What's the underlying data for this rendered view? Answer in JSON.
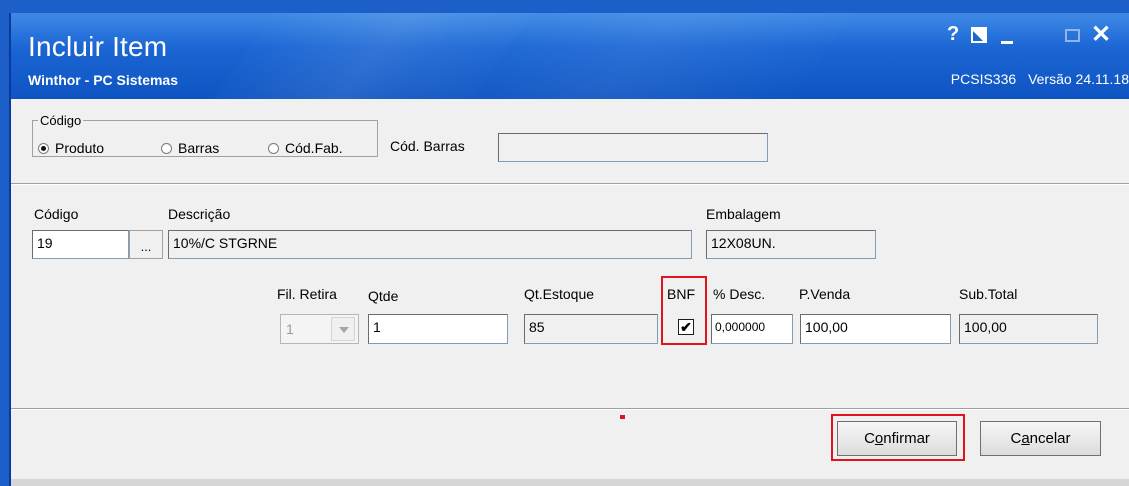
{
  "window": {
    "title": "Incluir Item",
    "subtitle": "Winthor - PC Sistemas",
    "program_code": "PCSIS336",
    "version": "Versão 24.11.18",
    "controls": {
      "help": "?",
      "close": "✕"
    }
  },
  "search": {
    "group_label": "Código",
    "options": [
      {
        "label": "Produto",
        "selected": true
      },
      {
        "label": "Barras",
        "selected": false
      },
      {
        "label": "Cód.Fab.",
        "selected": false
      }
    ],
    "barcode_label": "Cód. Barras",
    "barcode_value": ""
  },
  "item": {
    "codigo_label": "Código",
    "codigo_value": "19",
    "lookup_button": "...",
    "descricao_label": "Descrição",
    "descricao_value": "10%/C STGRNE",
    "embalagem_label": "Embalagem",
    "embalagem_value": "12X08UN."
  },
  "order": {
    "fil_retira_label": "Fil. Retira",
    "fil_retira_value": "1",
    "qtde_label": "Qtde",
    "qtde_value": "1",
    "qt_estoque_label": "Qt.Estoque",
    "qt_estoque_value": "85",
    "bnf_label": "BNF",
    "bnf_checked": true,
    "bnf_mark": "✔",
    "desc_label": "% Desc.",
    "desc_value": "0,000000",
    "pvenda_label": "P.Venda",
    "pvenda_value": "100,00",
    "subtotal_label": "Sub.Total",
    "subtotal_value": "100,00"
  },
  "buttons": {
    "confirm_first": "C",
    "confirm_underline": "o",
    "confirm_rest": "nfirmar",
    "cancel_first": "C",
    "cancel_underline": "a",
    "cancel_rest": "ncelar"
  },
  "colors": {
    "titlebar": "#1b66d4",
    "highlight": "#e0141e",
    "window_bg": "#f0f0f0"
  }
}
